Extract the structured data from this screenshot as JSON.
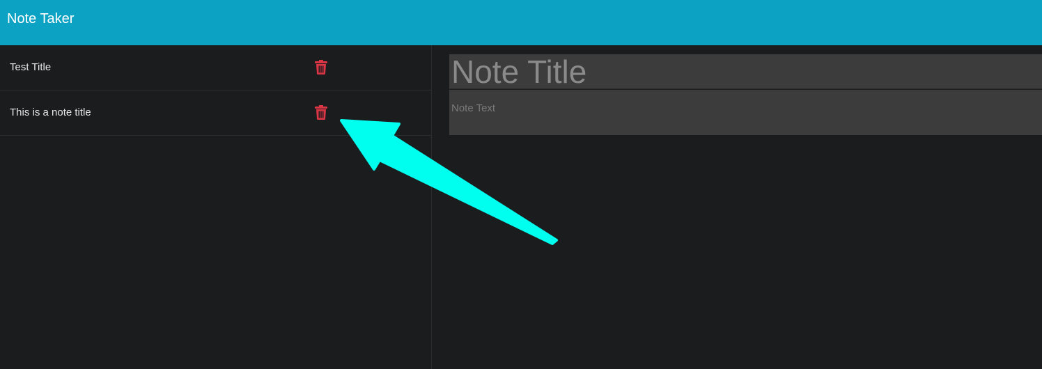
{
  "navbar": {
    "brand": "Note Taker"
  },
  "notes": [
    {
      "title": "Test Title"
    },
    {
      "title": "This is a note title"
    }
  ],
  "editor": {
    "title_placeholder": "Note Title",
    "text_placeholder": "Note Text"
  },
  "colors": {
    "navbar": "#0ca2c3",
    "background": "#1b1c1e",
    "delete_icon": "#dc3545",
    "annotation_arrow": "#00ffee"
  },
  "icons": {
    "delete": "trash-icon"
  }
}
